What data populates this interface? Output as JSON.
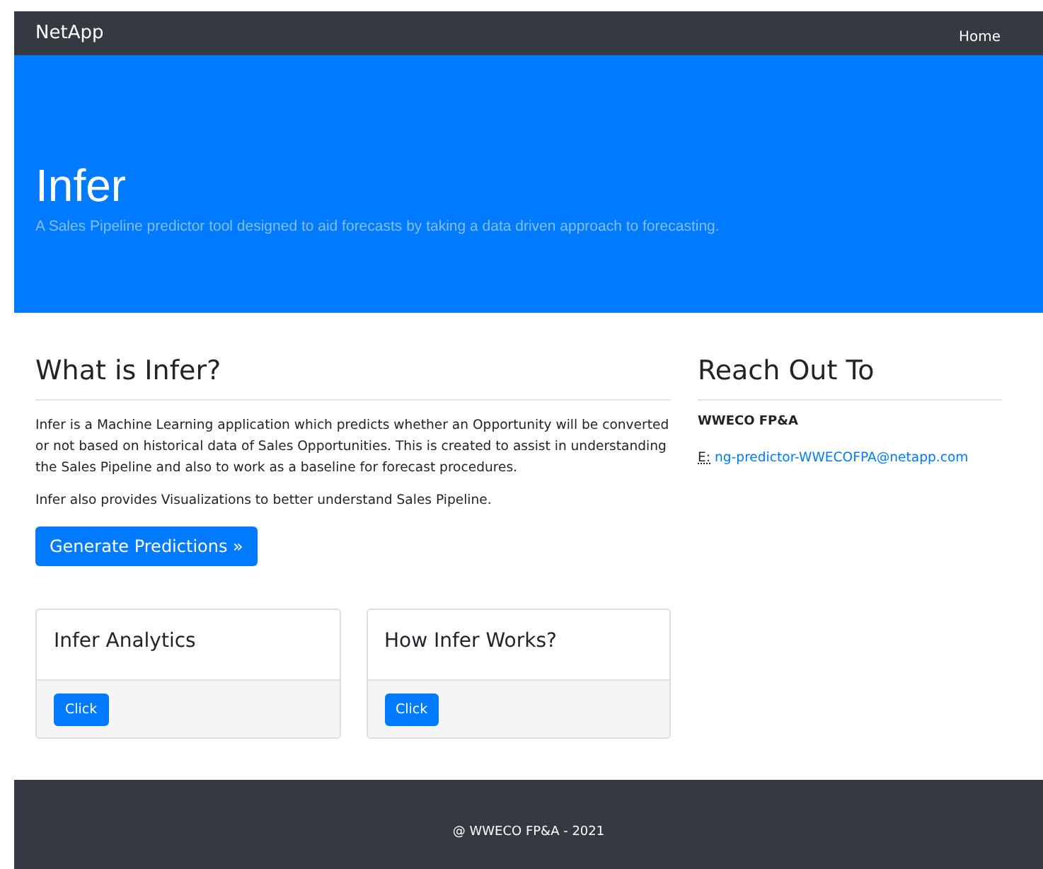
{
  "navbar": {
    "brand": "NetApp",
    "links": [
      {
        "label": "Home"
      }
    ]
  },
  "hero": {
    "title": "Infer",
    "subtitle": "A Sales Pipeline predictor tool designed to aid forecasts by taking a data driven approach to forecasting."
  },
  "about": {
    "heading": "What is Infer?",
    "paragraphs": [
      "Infer is a Machine Learning application which predicts whether an Opportunity will be converted or not based on historical data of Sales Opportunities. This is created to assist in understanding the Sales Pipeline and also to work as a baseline for forecast procedures.",
      "Infer also provides Visualizations to better understand Sales Pipeline."
    ],
    "button": "Generate Predictions »"
  },
  "cards": [
    {
      "title": "Infer Analytics",
      "button": "Click"
    },
    {
      "title": "How Infer Works?",
      "button": "Click"
    }
  ],
  "contact": {
    "heading": "Reach Out To",
    "team": "WWECO FP&A",
    "email_label": "E:",
    "email": "ng-predictor-WWECOFPA@netapp.com"
  },
  "footer": {
    "text": "@ WWECO FP&A - 2021"
  }
}
